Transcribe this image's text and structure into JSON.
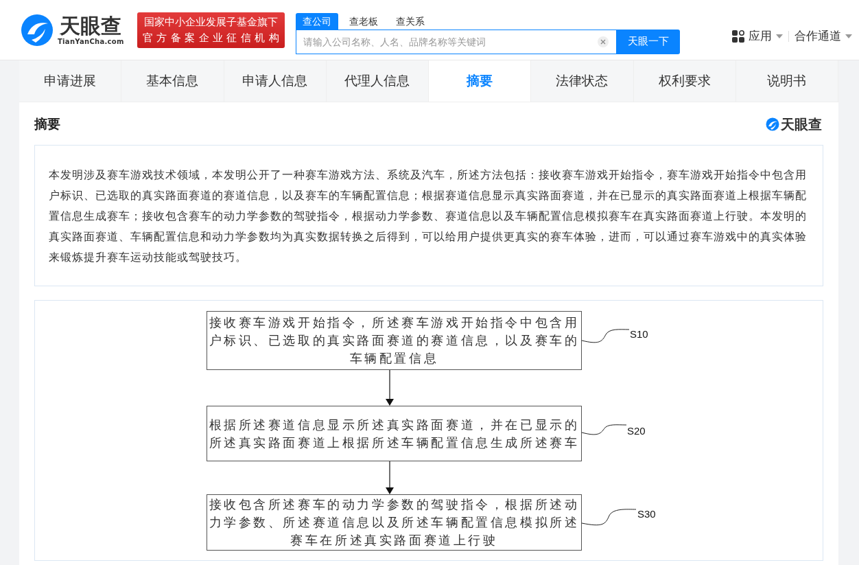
{
  "header": {
    "logo": {
      "name": "天眼查",
      "domain": "TianYanCha.com"
    },
    "badge": [
      "国家中小企业发展子基金旗下",
      "官方备案企业征信机构"
    ],
    "search_tabs": [
      {
        "label": "查公司",
        "selected": true
      },
      {
        "label": "查老板",
        "selected": false
      },
      {
        "label": "查关系",
        "selected": false
      }
    ],
    "search": {
      "placeholder": "请输入公司名称、人名、品牌名称等关键词",
      "button": "天眼一下"
    },
    "nav": [
      {
        "label": "应用",
        "kind": "apps"
      },
      {
        "label": "合作通道",
        "kind": "plain"
      }
    ]
  },
  "tabs": [
    {
      "label": "申请进展",
      "selected": false
    },
    {
      "label": "基本信息",
      "selected": false
    },
    {
      "label": "申请人信息",
      "selected": false
    },
    {
      "label": "代理人信息",
      "selected": false
    },
    {
      "label": "摘要",
      "selected": true
    },
    {
      "label": "法律状态",
      "selected": false
    },
    {
      "label": "权利要求",
      "selected": false
    },
    {
      "label": "说明书",
      "selected": false
    }
  ],
  "section": {
    "title": "摘要",
    "brand": "天眼查"
  },
  "abstract": "本发明涉及赛车游戏技术领域，本发明公开了一种赛车游戏方法、系统及汽车，所述方法包括：接收赛车游戏开始指令，赛车游戏开始指令中包含用户标识、已选取的真实路面赛道的赛道信息，以及赛车的车辆配置信息；根据赛道信息显示真实路面赛道，并在已显示的真实路面赛道上根据车辆配置信息生成赛车；接收包含赛车的动力学参数的驾驶指令，根据动力学参数、赛道信息以及车辆配置信息模拟赛车在真实路面赛道上行驶。本发明的真实路面赛道、车辆配置信息和动力学参数均为真实数据转换之后得到，可以给用户提供更真实的赛车体验，进而，可以通过赛车游戏中的真实体验来锻炼提升赛车运动技能或驾驶技巧。",
  "figure": {
    "steps": [
      {
        "text": "接收赛车游戏开始指令，所述赛车游戏开始指令中包含用户标识、已选取的真实路面赛道的赛道信息，以及赛车的车辆配置信息",
        "label": "S10"
      },
      {
        "text": "根据所述赛道信息显示所述真实路面赛道，并在已显示的所述真实路面赛道上根据所述车辆配置信息生成所述赛车",
        "label": "S20"
      },
      {
        "text": "接收包含所述赛车的动力学参数的驾驶指令，根据所述动力学参数、所述赛道信息以及所述车辆配置信息模拟所述赛车在所述真实路面赛道上行驶",
        "label": "S30"
      }
    ]
  }
}
